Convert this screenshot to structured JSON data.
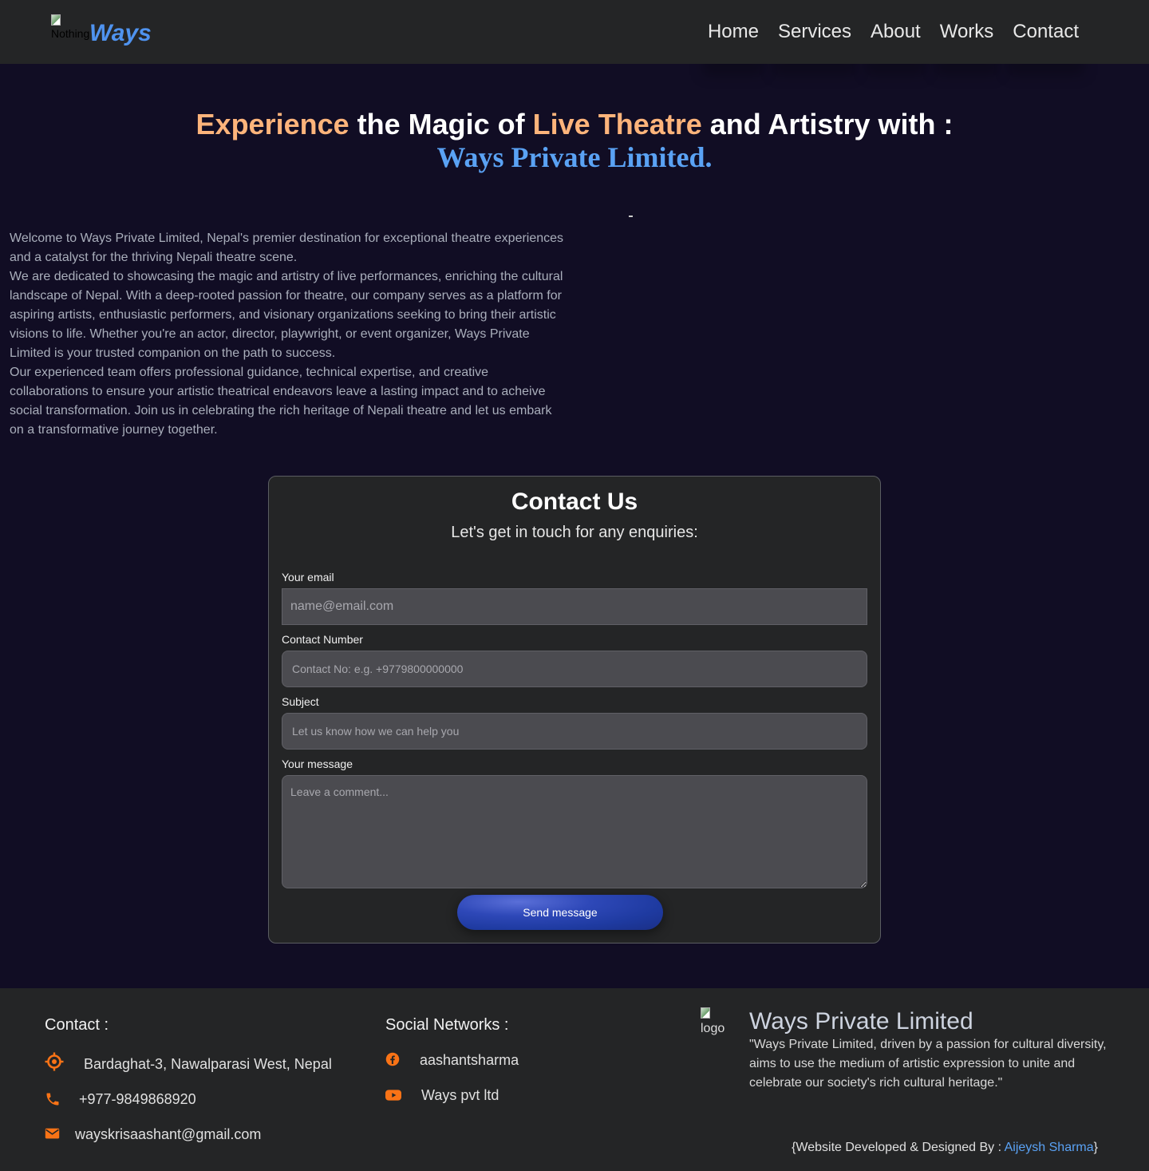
{
  "header": {
    "logo_alt": "Nothing",
    "brand": "Ways",
    "nav": [
      "Home",
      "Services",
      "About",
      "Works",
      "Contact"
    ]
  },
  "hero": {
    "title_part1": "Experience",
    "title_part2": " the Magic of ",
    "title_part3": "Live Theatre",
    "title_part4": " and Artistry with :",
    "subtitle": "Ways Private Limited.",
    "paragraphs": [
      "Welcome to Ways Private Limited, Nepal's premier destination for exceptional theatre experiences and a catalyst for the thriving Nepali theatre scene.",
      "We are dedicated to showcasing the magic and artistry of live performances, enriching the cultural landscape of Nepal. With a deep-rooted passion for theatre, our company serves as a platform for aspiring artists, enthusiastic performers, and visionary organizations seeking to bring their artistic visions to life. Whether you're an actor, director, playwright, or event organizer, Ways Private Limited is your trusted companion on the path to success.",
      "Our experienced team offers professional guidance, technical expertise, and creative collaborations to ensure your artistic theatrical endeavors leave a lasting impact and to acheive social transformation. Join us in celebrating the rich heritage of Nepali theatre and let us embark on a transformative journey together."
    ]
  },
  "contact_form": {
    "title": "Contact Us",
    "subtitle": "Let's get in touch for any enquiries:",
    "email_label": "Your email",
    "email_placeholder": "name@email.com",
    "phone_label": "Contact Number",
    "phone_placeholder": "Contact No: e.g. +9779800000000",
    "subject_label": "Subject",
    "subject_placeholder": "Let us know how we can help you",
    "message_label": "Your message",
    "message_placeholder": "Leave a comment...",
    "submit_label": "Send message"
  },
  "footer": {
    "contact_heading": "Contact :",
    "address": "Bardaghat-3, Nawalparasi West, Nepal",
    "phone": "+977-9849868920",
    "email": "wayskrisaashant@gmail.com",
    "social_heading": "Social Networks :",
    "facebook": "aashantsharma",
    "youtube": "Ways pvt ltd",
    "logo_alt": "logo",
    "brand": "Ways Private Limited",
    "quote": "\"Ways Private Limited, driven by a passion for cultural diversity, aims to use the medium of artistic expression to unite and celebrate our society's rich cultural heritage.\"",
    "credit_prefix": "{Website Developed & Designed By : ",
    "credit_name": "Aijeysh Sharma",
    "credit_suffix": "}",
    "icon_color": "#f97316"
  }
}
